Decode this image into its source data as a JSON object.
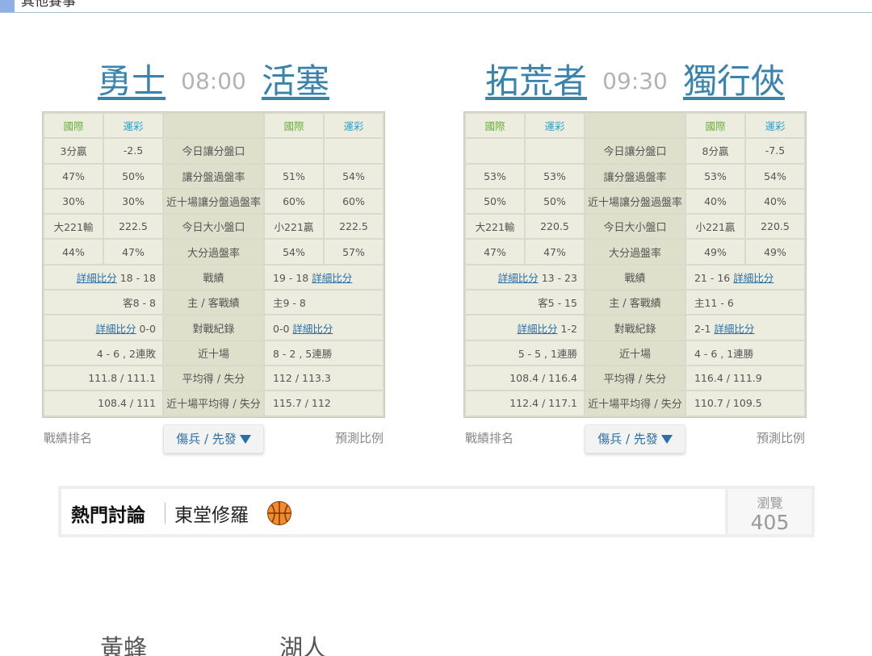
{
  "section_title": "其他賽事",
  "games": [
    {
      "away": "勇士",
      "time": "08:00",
      "home": "活塞",
      "headers": {
        "intl": "國際",
        "sports": "運彩"
      },
      "rows": [
        {
          "l1": "3分贏",
          "l2": "-2.5",
          "label": "今日讓分盤口",
          "r1": "",
          "r2": ""
        },
        {
          "l1": "47%",
          "l2": "50%",
          "label": "讓分盤過盤率",
          "r1": "51%",
          "r2": "54%"
        },
        {
          "l1": "30%",
          "l2": "30%",
          "label": "近十場讓分盤過盤率",
          "r1": "60%",
          "r2": "60%"
        },
        {
          "l1": "大221輸",
          "l2": "222.5",
          "label": "今日大小盤口",
          "r1": "小221贏",
          "r2": "222.5"
        },
        {
          "l1": "44%",
          "l2": "47%",
          "label": "大分過盤率",
          "r1": "54%",
          "r2": "57%"
        }
      ],
      "record": {
        "label": "戰績",
        "left_link": "詳細比分",
        "left": "18 - 18",
        "right": "19 - 18",
        "right_link": "詳細比分"
      },
      "homeaway": {
        "label": "主 / 客戰績",
        "left": "客8 - 8",
        "right": "主9 - 8"
      },
      "h2h": {
        "label": "對戰紀錄",
        "left_link": "詳細比分",
        "left": "0-0",
        "right": "0-0",
        "right_link": "詳細比分"
      },
      "last10": {
        "label": "近十場",
        "left": "4 - 6 , 2連敗",
        "right": "8 - 2 , 5連勝"
      },
      "avg": {
        "label": "平均得 / 失分",
        "left": "111.8 / 111.1",
        "right": "112 / 113.3"
      },
      "avg10": {
        "label": "近十場平均得 / 失分",
        "left": "108.4 / 111",
        "right": "115.7 / 112"
      },
      "rank_label": "戰績排名",
      "injury_label": "傷兵 / 先發",
      "predict_label": "預測比例"
    },
    {
      "away": "拓荒者",
      "time": "09:30",
      "home": "獨行俠",
      "headers": {
        "intl": "國際",
        "sports": "運彩"
      },
      "rows": [
        {
          "l1": "",
          "l2": "",
          "label": "今日讓分盤口",
          "r1": "8分贏",
          "r2": "-7.5"
        },
        {
          "l1": "53%",
          "l2": "53%",
          "label": "讓分盤過盤率",
          "r1": "53%",
          "r2": "54%"
        },
        {
          "l1": "50%",
          "l2": "50%",
          "label": "近十場讓分盤過盤率",
          "r1": "40%",
          "r2": "40%"
        },
        {
          "l1": "大221輸",
          "l2": "220.5",
          "label": "今日大小盤口",
          "r1": "小221贏",
          "r2": "220.5"
        },
        {
          "l1": "47%",
          "l2": "47%",
          "label": "大分過盤率",
          "r1": "49%",
          "r2": "49%"
        }
      ],
      "record": {
        "label": "戰績",
        "left_link": "詳細比分",
        "left": "13 - 23",
        "right": "21 - 16",
        "right_link": "詳細比分"
      },
      "homeaway": {
        "label": "主 / 客戰績",
        "left": "客5 - 15",
        "right": "主11 - 6"
      },
      "h2h": {
        "label": "對戰紀錄",
        "left_link": "詳細比分",
        "left": "1-2",
        "right": "2-1",
        "right_link": "詳細比分"
      },
      "last10": {
        "label": "近十場",
        "left": "5 - 5 , 1連勝",
        "right": "4 - 6 , 1連勝"
      },
      "avg": {
        "label": "平均得 / 失分",
        "left": "108.4 / 116.4",
        "right": "116.4 / 111.9"
      },
      "avg10": {
        "label": "近十場平均得 / 失分",
        "left": "112.4 / 117.1",
        "right": "110.7 / 109.5"
      },
      "rank_label": "戰績排名",
      "injury_label": "傷兵 / 先發",
      "predict_label": "預測比例"
    }
  ],
  "hot": {
    "label": "熱門討論",
    "topic": "東堂修羅",
    "views_label": "瀏覽",
    "views": "405",
    "icon": "basketball-icon"
  },
  "next_game": {
    "away": "黃蜂",
    "home": "湖人"
  }
}
